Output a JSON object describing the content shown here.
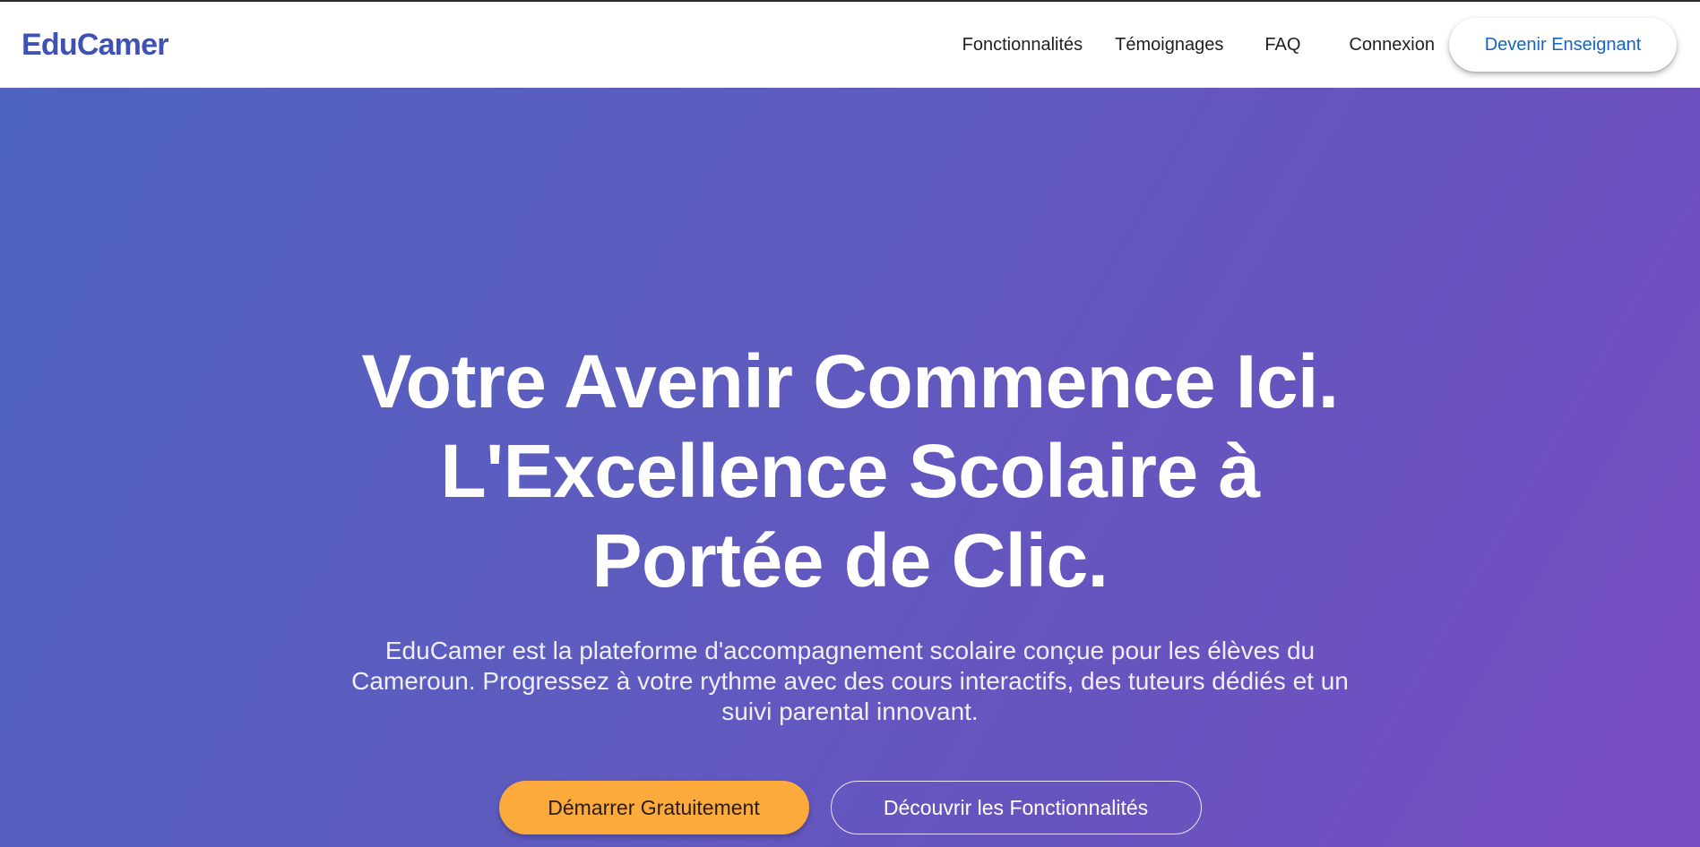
{
  "header": {
    "brand": "EduCamer",
    "nav": [
      {
        "label": "Fonctionnalités"
      },
      {
        "label": "Témoignages"
      },
      {
        "label": "FAQ"
      },
      {
        "label": "Connexion"
      }
    ],
    "cta_label": "Devenir Enseignant"
  },
  "hero": {
    "title": "Votre Avenir Commence Ici. L'Excellence Scolaire à Portée de Clic.",
    "subtitle": "EduCamer est la plateforme d'accompagnement scolaire conçue pour les élèves du Cameroun. Progressez à votre rythme avec des cours interactifs, des tuteurs dédiés et un suivi parental innovant.",
    "primary_button": "Démarrer Gratuitement",
    "secondary_button": "Découvrir les Fonctionnalités"
  },
  "colors": {
    "brand": "#3f51b5",
    "hero_gradient_start": "#4e63c0",
    "hero_gradient_end": "#7a4dc2",
    "primary_button": "#fcaa3c",
    "cta_text": "#1565c0"
  }
}
